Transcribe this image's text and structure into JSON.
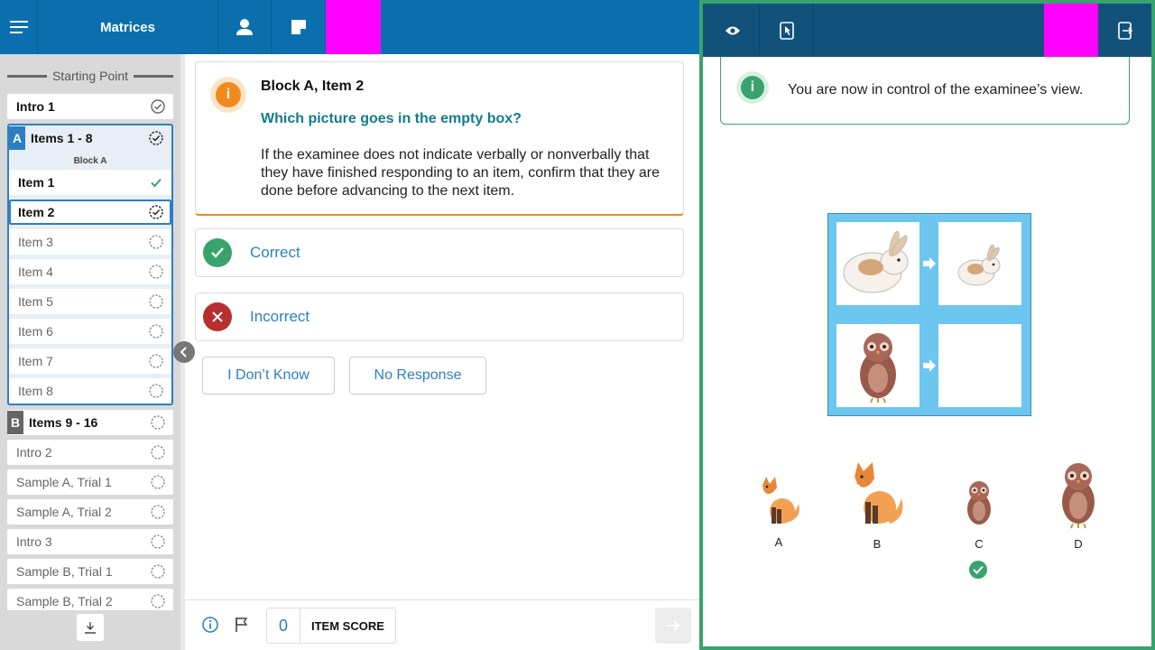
{
  "header": {
    "title": "Matrices",
    "icons": [
      "menu-icon",
      "user-icon",
      "note-icon"
    ]
  },
  "sidebar": {
    "starting_point": "Starting Point",
    "intro1": "Intro 1",
    "blockA": {
      "letter": "A",
      "title": "Items 1 - 8",
      "label": "Block A",
      "items": [
        "Item 1",
        "Item 2",
        "Item 3",
        "Item 4",
        "Item 5",
        "Item 6",
        "Item 7",
        "Item 8"
      ]
    },
    "blockB": {
      "letter": "B",
      "title": "Items 9 - 16"
    },
    "rest": [
      "Intro 2",
      "Sample A, Trial 1",
      "Sample A, Trial 2",
      "Intro 3",
      "Sample B, Trial 1",
      "Sample B, Trial 2"
    ]
  },
  "instruction": {
    "title": "Block A, Item 2",
    "question": "Which picture goes in the empty box?",
    "body": "If the examinee does not indicate verbally or nonverbally that they have finished responding to an item, confirm that they are done before advancing to the next item."
  },
  "answers": {
    "correct": "Correct",
    "incorrect": "Incorrect",
    "dont_know": "I Don’t Know",
    "no_response": "No Response"
  },
  "footer": {
    "score_value": "0",
    "score_label": "ITEM SCORE"
  },
  "examinee": {
    "banner": "You are now in control of the examinee’s view.",
    "options": [
      "A",
      "B",
      "C",
      "D"
    ],
    "selected_option": "C"
  },
  "colors": {
    "brand_blue": "#0b6fad",
    "examinee_header": "#12527a",
    "accent_green": "#39a36e",
    "warning_orange": "#f08a1c",
    "error_red": "#b92e2e",
    "matrix_blue": "#6cc6f0"
  }
}
